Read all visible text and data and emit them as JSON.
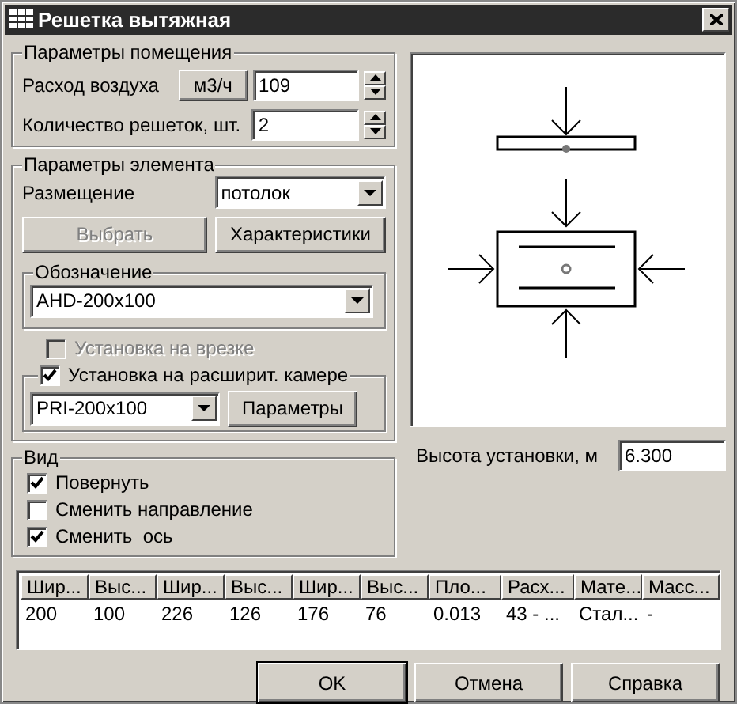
{
  "window": {
    "title": "Решетка вытяжная"
  },
  "room": {
    "title": "Параметры помещения",
    "air_flow": {
      "label": "Расход воздуха",
      "unit_button": "м3/ч",
      "value": "109"
    },
    "grille_count": {
      "label": "Количество решеток, шт.",
      "value": "2"
    }
  },
  "element": {
    "title": "Параметры элемента",
    "placement": {
      "label": "Размещение",
      "value": "потолок"
    },
    "buttons": [
      {
        "label": "Выбрать",
        "disabled": true
      },
      {
        "label": "Характеристики",
        "disabled": false
      }
    ],
    "designation": {
      "title": "Обозначение",
      "value": "AHD-200x100"
    },
    "insert_mount": {
      "label": "Установка на врезке",
      "checked": false,
      "disabled": true
    },
    "chamber_mount": {
      "label": "Установка на расширит. камере",
      "checked": true,
      "value": "PRI-200x100",
      "button": "Параметры"
    }
  },
  "view": {
    "title": "Вид",
    "options": [
      {
        "label": "Повернуть",
        "checked": true
      },
      {
        "label": "Сменить направление",
        "checked": false
      },
      {
        "label": "Сменить  ось",
        "checked": true
      }
    ]
  },
  "height": {
    "label": "Высота установки, м",
    "value": "6.300"
  },
  "table": {
    "columns": [
      "Шир...",
      "Выс...",
      "Шир...",
      "Выс...",
      "Шир...",
      "Выс...",
      "Пло...",
      "Расх...",
      "Мате...",
      "Масс..."
    ],
    "rows": [
      [
        "200",
        "100",
        "226",
        "126",
        "176",
        "76",
        "0.013",
        "43 - ...",
        "Стал...",
        "-"
      ]
    ]
  },
  "buttons": [
    {
      "label": "OK",
      "default": true
    },
    {
      "label": "Отмена",
      "default": false
    },
    {
      "label": "Справка",
      "default": false
    }
  ]
}
